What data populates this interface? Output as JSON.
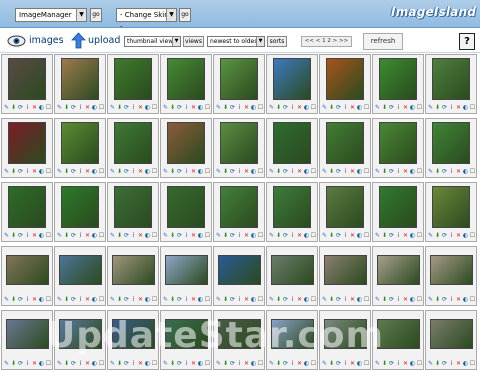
{
  "top": {
    "module_select": "ImageManager",
    "go_label": "go",
    "skin_select": "- Change Skins -",
    "logo": "ImageIsland"
  },
  "toolbar": {
    "images_label": "images",
    "upload_label": "upload",
    "view_select": "thumbnail view",
    "views_button": "views",
    "sort_select": "newest to oldest",
    "sorts_button": "sorts",
    "pager": "<< < 1 2 > >>",
    "refresh_label": "refresh",
    "help_label": "?"
  },
  "action_icons": [
    "edit-icon",
    "download-icon",
    "sync-icon",
    "info-icon",
    "delete-icon",
    "gallery-icon",
    "select-icon"
  ],
  "action_glyphs": [
    "✎",
    "⬇",
    "⟳",
    "i",
    "✕",
    "◐",
    "☐"
  ],
  "thumbnails": [
    [
      "#5a4a46",
      "#9c7a4e",
      "#3f7b2c",
      "#478a35",
      "#5b9442",
      "#3c7ac0",
      "#a7541b",
      "#3c8c31",
      "#4f7f3e"
    ],
    [
      "#7c1d29",
      "#5a8c33",
      "#3e7a37",
      "#8a5c3a",
      "#5a8d44",
      "#2f6c31",
      "#437d34",
      "#4b8736",
      "#3f8537"
    ],
    [
      "#2d6c2a",
      "#2d7a2a",
      "#3d6e38",
      "#356b2f",
      "#43803b",
      "#3d7c3b",
      "#5d7a42",
      "#2f7a2f",
      "#6d873a"
    ],
    [
      "#827458",
      "#4d7596",
      "#a0957e",
      "#8fa6c9",
      "#2a5b93",
      "#6a7d6b",
      "#8a8070",
      "#a59f8b",
      "#a69a86"
    ],
    [
      "#6a7791",
      "#5c7a9c",
      "#3a5d88",
      "#3c6e52",
      "#4a5b47",
      "#8aa1c5",
      "#7a8a7d",
      "#5f7a4f",
      "#7a7c6c"
    ]
  ],
  "landscape_rows": [
    3,
    4
  ],
  "watermark": "UpdateStar.com"
}
